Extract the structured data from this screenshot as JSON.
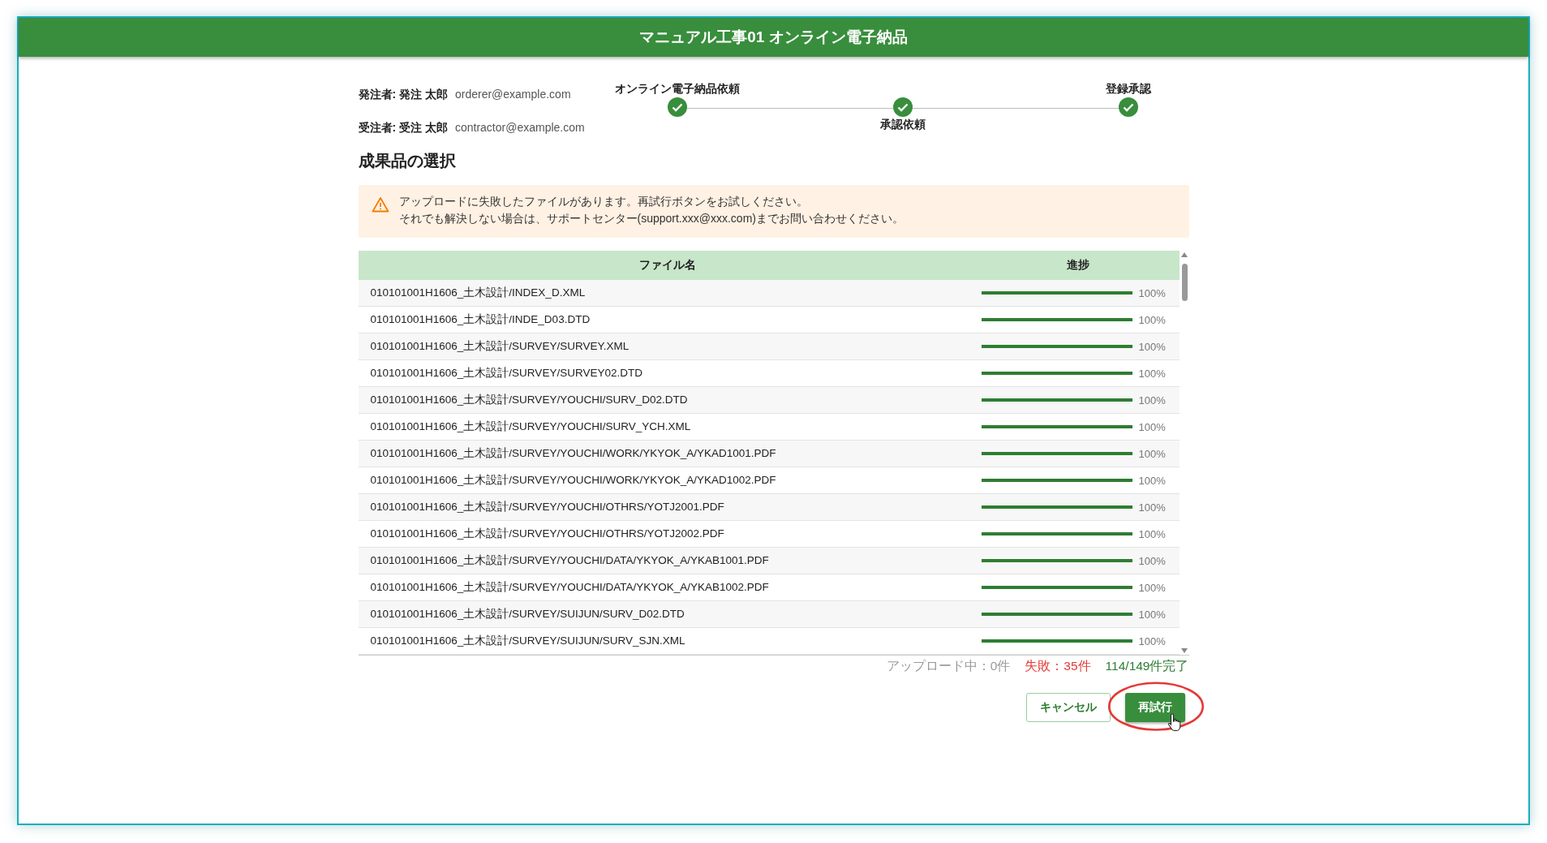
{
  "window": {
    "title": "マニュアル工事01 オンライン電子納品"
  },
  "parties": [
    {
      "label": "発注者: 発注 太郎",
      "email": "orderer@example.com"
    },
    {
      "label": "受注者: 受注 太郎",
      "email": "contractor@example.com"
    }
  ],
  "steps": [
    {
      "label": "オンライン電子納品依頼",
      "done": true
    },
    {
      "label": "承認依頼",
      "done": true
    },
    {
      "label": "登録承認",
      "done": true
    }
  ],
  "section_title": "成果品の選択",
  "alert": {
    "lines": [
      "アップロードに失敗したファイルがあります。再試行ボタンをお試しください。",
      "それでも解決しない場合は、サポートセンター(support.xxx@xxx.com)までお問い合わせください。"
    ]
  },
  "table": {
    "columns": [
      "ファイル名",
      "進捗"
    ],
    "rows": [
      {
        "name": "010101001H1606_土木設計/INDEX_D.XML",
        "level": 1,
        "reading": "100%"
      },
      {
        "name": "010101001H1606_土木設計/INDE_D03.DTD",
        "level": 1,
        "reading": "100%"
      },
      {
        "name": "010101001H1606_土木設計/SURVEY/SURVEY.XML",
        "level": 1,
        "reading": "100%"
      },
      {
        "name": "010101001H1606_土木設計/SURVEY/SURVEY02.DTD",
        "level": 1,
        "reading": "100%"
      },
      {
        "name": "010101001H1606_土木設計/SURVEY/YOUCHI/SURV_D02.DTD",
        "level": 1,
        "reading": "100%"
      },
      {
        "name": "010101001H1606_土木設計/SURVEY/YOUCHI/SURV_YCH.XML",
        "level": 1,
        "reading": "100%"
      },
      {
        "name": "010101001H1606_土木設計/SURVEY/YOUCHI/WORK/YKYOK_A/YKAD1001.PDF",
        "level": 1,
        "reading": "100%"
      },
      {
        "name": "010101001H1606_土木設計/SURVEY/YOUCHI/WORK/YKYOK_A/YKAD1002.PDF",
        "level": 1,
        "reading": "100%"
      },
      {
        "name": "010101001H1606_土木設計/SURVEY/YOUCHI/OTHRS/YOTJ2001.PDF",
        "level": 1,
        "reading": "100%"
      },
      {
        "name": "010101001H1606_土木設計/SURVEY/YOUCHI/OTHRS/YOTJ2002.PDF",
        "level": 1,
        "reading": "100%"
      },
      {
        "name": "010101001H1606_土木設計/SURVEY/YOUCHI/DATA/YKYOK_A/YKAB1001.PDF",
        "level": 1,
        "reading": "100%"
      },
      {
        "name": "010101001H1606_土木設計/SURVEY/YOUCHI/DATA/YKYOK_A/YKAB1002.PDF",
        "level": 1,
        "reading": "100%"
      },
      {
        "name": "010101001H1606_土木設計/SURVEY/SUIJUN/SURV_D02.DTD",
        "level": 1,
        "reading": "100%"
      },
      {
        "name": "010101001H1606_土木設計/SURVEY/SUIJUN/SURV_SJN.XML",
        "level": 1,
        "reading": "100%"
      }
    ]
  },
  "status": {
    "uploading": "アップロード中：0件",
    "failed": "失敗：35件",
    "completed": "114/149件完了"
  },
  "buttons": [
    {
      "label": "キャンセル",
      "kind": "outlined"
    },
    {
      "label": "再試行",
      "kind": "primary",
      "highlighted": true
    }
  ]
}
